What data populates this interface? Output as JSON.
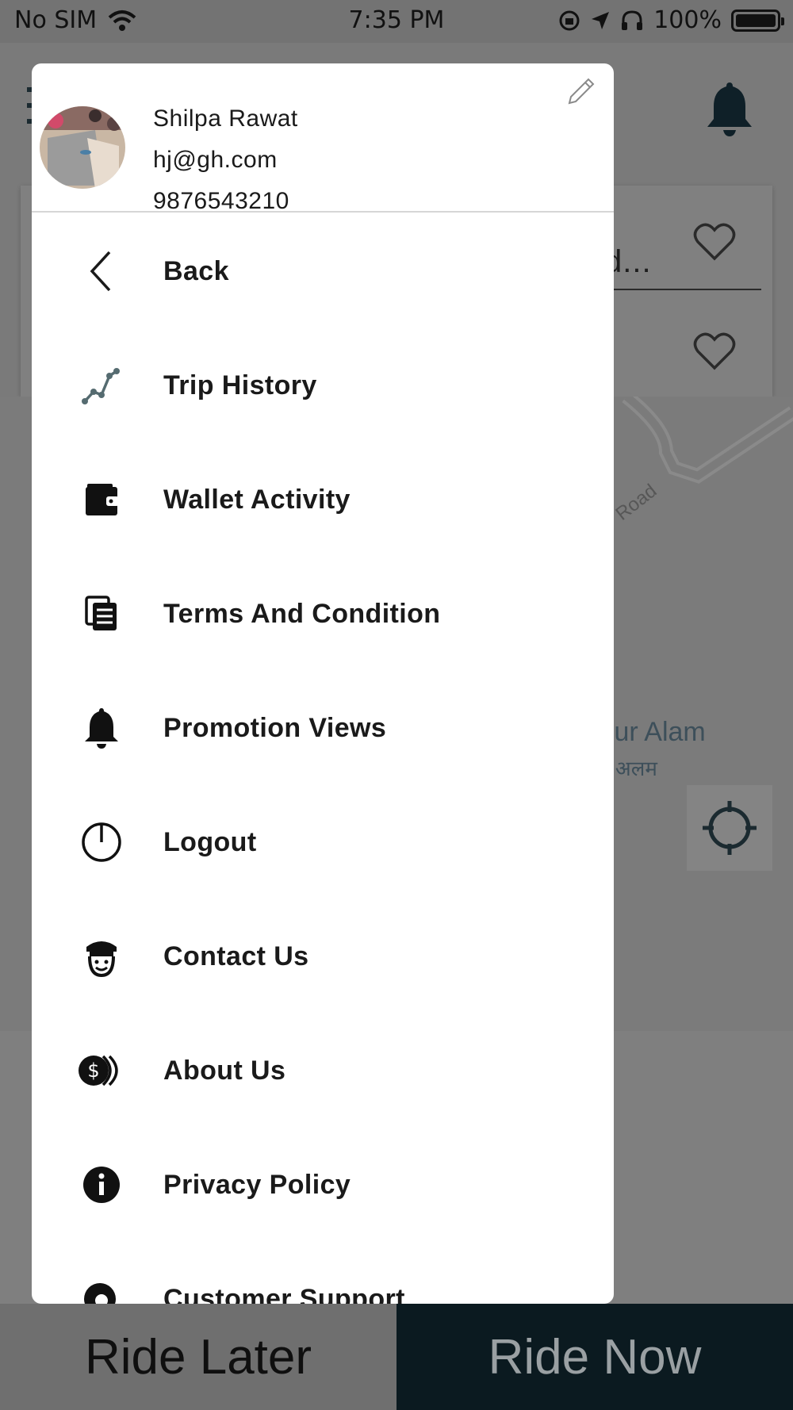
{
  "status_bar": {
    "carrier": "No SIM",
    "time": "7:35 PM",
    "battery": "100%"
  },
  "background": {
    "search_partial_text": "d...",
    "road_label": "Road",
    "place_name_en": "lpur Alam",
    "place_name_hi": "र अलम",
    "ride_later_label": "Ride Later",
    "ride_now_label": "Ride Now"
  },
  "drawer": {
    "profile": {
      "name": "Shilpa Rawat",
      "email": "hj@gh.com",
      "phone": "9876543210"
    },
    "menu": [
      {
        "label": "Back",
        "icon": "chevron-left-icon"
      },
      {
        "label": "Trip History",
        "icon": "route-icon"
      },
      {
        "label": "Wallet Activity",
        "icon": "wallet-icon"
      },
      {
        "label": "Terms And Condition",
        "icon": "document-icon"
      },
      {
        "label": "Promotion Views",
        "icon": "bell-icon"
      },
      {
        "label": "Logout",
        "icon": "power-icon"
      },
      {
        "label": "Contact Us",
        "icon": "driver-icon"
      },
      {
        "label": "About Us",
        "icon": "coins-icon"
      },
      {
        "label": "Privacy Policy",
        "icon": "info-icon"
      },
      {
        "label": "Customer Support",
        "icon": "support-icon"
      }
    ]
  },
  "colors": {
    "drawer_bg": "#ffffff",
    "overlay": "#7a7a7a",
    "ride_now_bg": "#0b1a20",
    "text": "#1a1a1a"
  }
}
